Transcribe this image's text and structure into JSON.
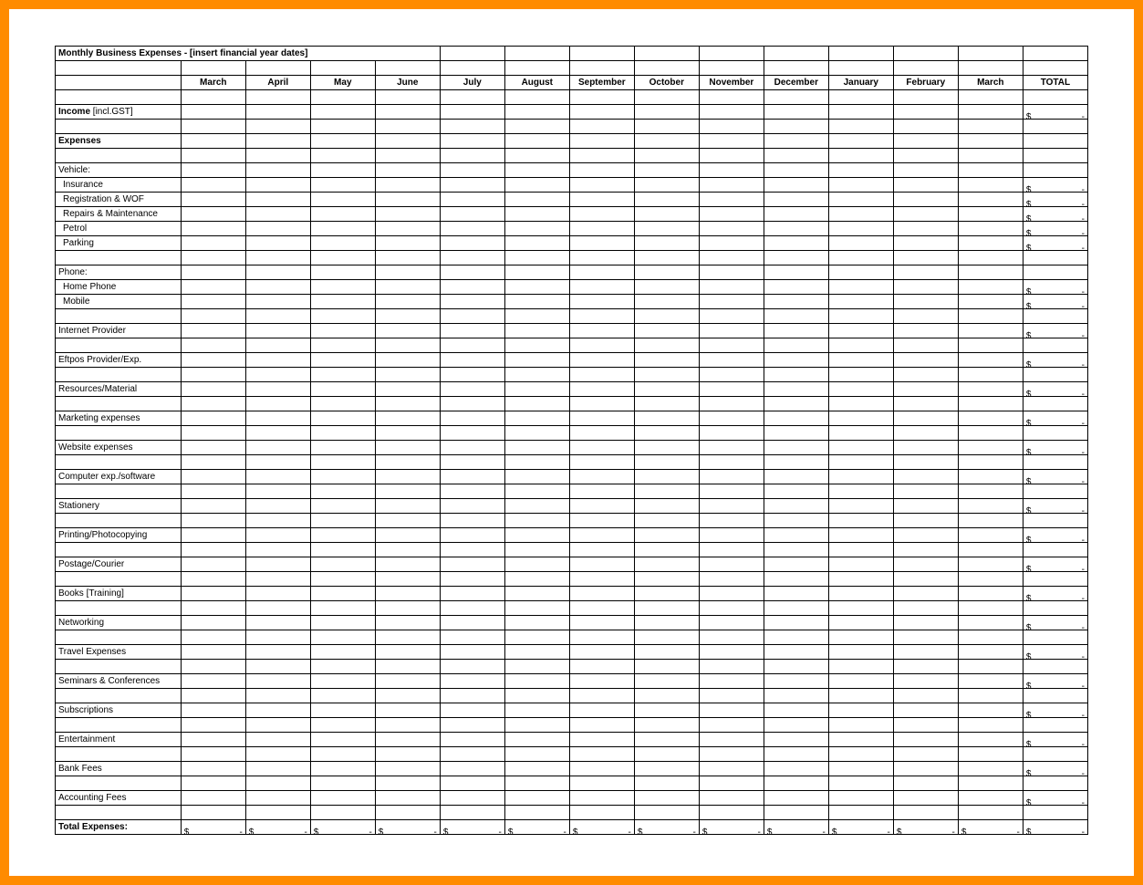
{
  "title": "Monthly Business Expenses - [insert financial year dates]",
  "months": [
    "March",
    "April",
    "May",
    "June",
    "July",
    "August",
    "September",
    "October",
    "November",
    "December",
    "January",
    "February",
    "March"
  ],
  "total_label": "TOTAL",
  "income_label_bold": "Income",
  "income_label_rest": " [incl.GST]",
  "expenses_label": "Expenses",
  "vehicle_label": "Vehicle:",
  "vehicle_items": [
    "Insurance",
    "Registration & WOF",
    "Repairs & Maintenance",
    "Petrol",
    "Parking"
  ],
  "phone_label": "Phone:",
  "phone_items": [
    "Home Phone",
    "Mobile"
  ],
  "standalone_items": [
    "Internet Provider",
    "Eftpos Provider/Exp.",
    "Resources/Material",
    "Marketing expenses",
    "Website expenses",
    "Computer exp./software",
    "Stationery",
    "Printing/Photocopying",
    "Postage/Courier",
    "Books [Training]",
    "Networking",
    "Travel Expenses",
    "Seminars & Conferences",
    "Subscriptions",
    "Entertainment",
    "Bank Fees",
    "Accounting Fees"
  ],
  "total_expenses_label": "Total Expenses:",
  "currency": {
    "symbol": "$",
    "dash": "-"
  }
}
